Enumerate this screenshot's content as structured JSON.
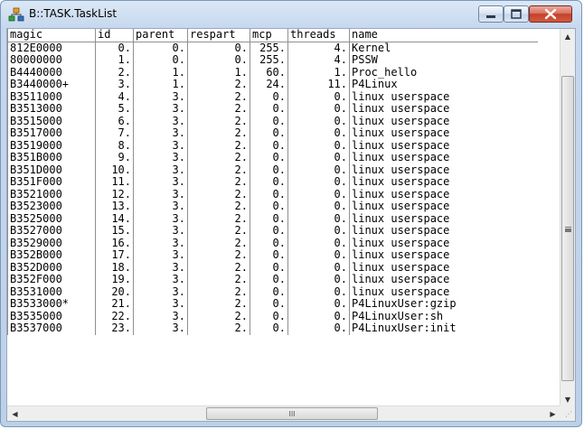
{
  "window": {
    "title": "B::TASK.TaskList",
    "icon": "task-tree-icon"
  },
  "table": {
    "columns": [
      "magic",
      "id",
      "parent",
      "respart",
      "mcp",
      "threads",
      "name"
    ],
    "rows": [
      [
        "812E0000",
        "0.",
        "0.",
        "0.",
        "255.",
        "4.",
        "Kernel"
      ],
      [
        "80000000",
        "1.",
        "0.",
        "0.",
        "255.",
        "4.",
        "PSSW"
      ],
      [
        "B4440000",
        "2.",
        "1.",
        "1.",
        "60.",
        "1.",
        "Proc_hello"
      ],
      [
        "B3440000+",
        "3.",
        "1.",
        "2.",
        "24.",
        "11.",
        "P4Linux"
      ],
      [
        "B3511000",
        "4.",
        "3.",
        "2.",
        "0.",
        "0.",
        "linux userspace"
      ],
      [
        "B3513000",
        "5.",
        "3.",
        "2.",
        "0.",
        "0.",
        "linux userspace"
      ],
      [
        "B3515000",
        "6.",
        "3.",
        "2.",
        "0.",
        "0.",
        "linux userspace"
      ],
      [
        "B3517000",
        "7.",
        "3.",
        "2.",
        "0.",
        "0.",
        "linux userspace"
      ],
      [
        "B3519000",
        "8.",
        "3.",
        "2.",
        "0.",
        "0.",
        "linux userspace"
      ],
      [
        "B351B000",
        "9.",
        "3.",
        "2.",
        "0.",
        "0.",
        "linux userspace"
      ],
      [
        "B351D000",
        "10.",
        "3.",
        "2.",
        "0.",
        "0.",
        "linux userspace"
      ],
      [
        "B351F000",
        "11.",
        "3.",
        "2.",
        "0.",
        "0.",
        "linux userspace"
      ],
      [
        "B3521000",
        "12.",
        "3.",
        "2.",
        "0.",
        "0.",
        "linux userspace"
      ],
      [
        "B3523000",
        "13.",
        "3.",
        "2.",
        "0.",
        "0.",
        "linux userspace"
      ],
      [
        "B3525000",
        "14.",
        "3.",
        "2.",
        "0.",
        "0.",
        "linux userspace"
      ],
      [
        "B3527000",
        "15.",
        "3.",
        "2.",
        "0.",
        "0.",
        "linux userspace"
      ],
      [
        "B3529000",
        "16.",
        "3.",
        "2.",
        "0.",
        "0.",
        "linux userspace"
      ],
      [
        "B352B000",
        "17.",
        "3.",
        "2.",
        "0.",
        "0.",
        "linux userspace"
      ],
      [
        "B352D000",
        "18.",
        "3.",
        "2.",
        "0.",
        "0.",
        "linux userspace"
      ],
      [
        "B352F000",
        "19.",
        "3.",
        "2.",
        "0.",
        "0.",
        "linux userspace"
      ],
      [
        "B3531000",
        "20.",
        "3.",
        "2.",
        "0.",
        "0.",
        "linux userspace"
      ],
      [
        "B3533000*",
        "21.",
        "3.",
        "2.",
        "0.",
        "0.",
        "P4LinuxUser:gzip"
      ],
      [
        "B3535000",
        "22.",
        "3.",
        "2.",
        "0.",
        "0.",
        "P4LinuxUser:sh"
      ],
      [
        "B3537000",
        "23.",
        "3.",
        "2.",
        "0.",
        "0.",
        "P4LinuxUser:init"
      ]
    ]
  },
  "scrollbars": {
    "hscroll_grip": "III"
  },
  "colors": {
    "titlebar": "#c6d8ee",
    "close_button": "#c4412c",
    "grid_line": "#909090"
  }
}
